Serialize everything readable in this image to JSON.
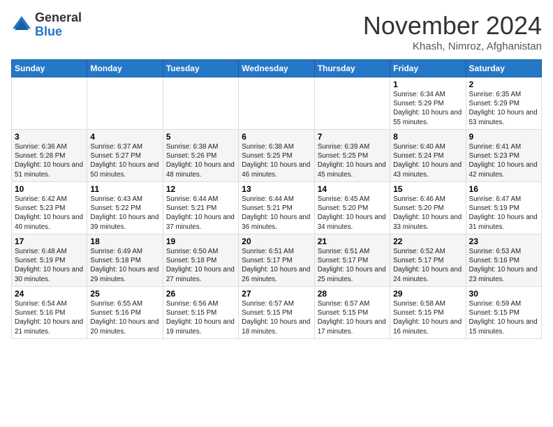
{
  "logo": {
    "general": "General",
    "blue": "Blue"
  },
  "header": {
    "month": "November 2024",
    "location": "Khash, Nimroz, Afghanistan"
  },
  "days": [
    "Sunday",
    "Monday",
    "Tuesday",
    "Wednesday",
    "Thursday",
    "Friday",
    "Saturday"
  ],
  "weeks": [
    [
      {
        "day": "",
        "text": ""
      },
      {
        "day": "",
        "text": ""
      },
      {
        "day": "",
        "text": ""
      },
      {
        "day": "",
        "text": ""
      },
      {
        "day": "",
        "text": ""
      },
      {
        "day": "1",
        "text": "Sunrise: 6:34 AM\nSunset: 5:29 PM\nDaylight: 10 hours and 55 minutes."
      },
      {
        "day": "2",
        "text": "Sunrise: 6:35 AM\nSunset: 5:29 PM\nDaylight: 10 hours and 53 minutes."
      }
    ],
    [
      {
        "day": "3",
        "text": "Sunrise: 6:36 AM\nSunset: 5:28 PM\nDaylight: 10 hours and 51 minutes."
      },
      {
        "day": "4",
        "text": "Sunrise: 6:37 AM\nSunset: 5:27 PM\nDaylight: 10 hours and 50 minutes."
      },
      {
        "day": "5",
        "text": "Sunrise: 6:38 AM\nSunset: 5:26 PM\nDaylight: 10 hours and 48 minutes."
      },
      {
        "day": "6",
        "text": "Sunrise: 6:38 AM\nSunset: 5:25 PM\nDaylight: 10 hours and 46 minutes."
      },
      {
        "day": "7",
        "text": "Sunrise: 6:39 AM\nSunset: 5:25 PM\nDaylight: 10 hours and 45 minutes."
      },
      {
        "day": "8",
        "text": "Sunrise: 6:40 AM\nSunset: 5:24 PM\nDaylight: 10 hours and 43 minutes."
      },
      {
        "day": "9",
        "text": "Sunrise: 6:41 AM\nSunset: 5:23 PM\nDaylight: 10 hours and 42 minutes."
      }
    ],
    [
      {
        "day": "10",
        "text": "Sunrise: 6:42 AM\nSunset: 5:23 PM\nDaylight: 10 hours and 40 minutes."
      },
      {
        "day": "11",
        "text": "Sunrise: 6:43 AM\nSunset: 5:22 PM\nDaylight: 10 hours and 39 minutes."
      },
      {
        "day": "12",
        "text": "Sunrise: 6:44 AM\nSunset: 5:21 PM\nDaylight: 10 hours and 37 minutes."
      },
      {
        "day": "13",
        "text": "Sunrise: 6:44 AM\nSunset: 5:21 PM\nDaylight: 10 hours and 36 minutes."
      },
      {
        "day": "14",
        "text": "Sunrise: 6:45 AM\nSunset: 5:20 PM\nDaylight: 10 hours and 34 minutes."
      },
      {
        "day": "15",
        "text": "Sunrise: 6:46 AM\nSunset: 5:20 PM\nDaylight: 10 hours and 33 minutes."
      },
      {
        "day": "16",
        "text": "Sunrise: 6:47 AM\nSunset: 5:19 PM\nDaylight: 10 hours and 31 minutes."
      }
    ],
    [
      {
        "day": "17",
        "text": "Sunrise: 6:48 AM\nSunset: 5:19 PM\nDaylight: 10 hours and 30 minutes."
      },
      {
        "day": "18",
        "text": "Sunrise: 6:49 AM\nSunset: 5:18 PM\nDaylight: 10 hours and 29 minutes."
      },
      {
        "day": "19",
        "text": "Sunrise: 6:50 AM\nSunset: 5:18 PM\nDaylight: 10 hours and 27 minutes."
      },
      {
        "day": "20",
        "text": "Sunrise: 6:51 AM\nSunset: 5:17 PM\nDaylight: 10 hours and 26 minutes."
      },
      {
        "day": "21",
        "text": "Sunrise: 6:51 AM\nSunset: 5:17 PM\nDaylight: 10 hours and 25 minutes."
      },
      {
        "day": "22",
        "text": "Sunrise: 6:52 AM\nSunset: 5:17 PM\nDaylight: 10 hours and 24 minutes."
      },
      {
        "day": "23",
        "text": "Sunrise: 6:53 AM\nSunset: 5:16 PM\nDaylight: 10 hours and 23 minutes."
      }
    ],
    [
      {
        "day": "24",
        "text": "Sunrise: 6:54 AM\nSunset: 5:16 PM\nDaylight: 10 hours and 21 minutes."
      },
      {
        "day": "25",
        "text": "Sunrise: 6:55 AM\nSunset: 5:16 PM\nDaylight: 10 hours and 20 minutes."
      },
      {
        "day": "26",
        "text": "Sunrise: 6:56 AM\nSunset: 5:15 PM\nDaylight: 10 hours and 19 minutes."
      },
      {
        "day": "27",
        "text": "Sunrise: 6:57 AM\nSunset: 5:15 PM\nDaylight: 10 hours and 18 minutes."
      },
      {
        "day": "28",
        "text": "Sunrise: 6:57 AM\nSunset: 5:15 PM\nDaylight: 10 hours and 17 minutes."
      },
      {
        "day": "29",
        "text": "Sunrise: 6:58 AM\nSunset: 5:15 PM\nDaylight: 10 hours and 16 minutes."
      },
      {
        "day": "30",
        "text": "Sunrise: 6:59 AM\nSunset: 5:15 PM\nDaylight: 10 hours and 15 minutes."
      }
    ]
  ]
}
